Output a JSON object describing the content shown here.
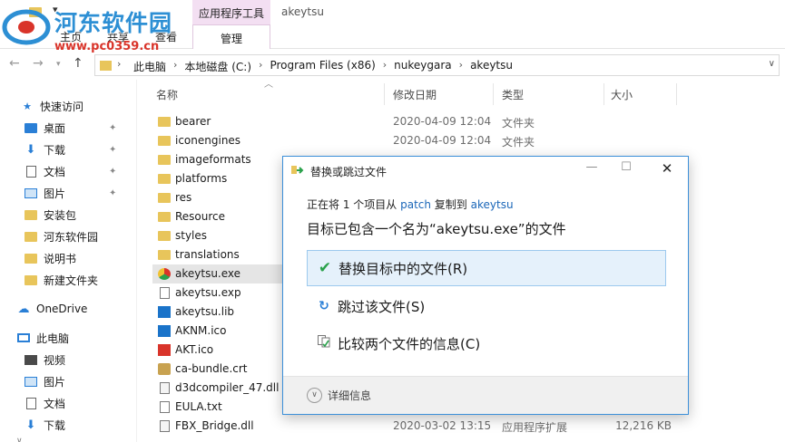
{
  "window": {
    "title": "akeytsu"
  },
  "ribbon": {
    "tabs": [
      "主页",
      "共享",
      "查看"
    ],
    "context_group": "应用程序工具",
    "context_tab": "管理"
  },
  "watermark": {
    "title": "河东软件园",
    "url": "www.pc0359.cn"
  },
  "address": {
    "crumbs": [
      "此电脑",
      "本地磁盘 (C:)",
      "Program Files (x86)",
      "nukeygara",
      "akeytsu"
    ]
  },
  "sidebar": {
    "quick_access": "快速访问",
    "items": [
      {
        "label": "桌面",
        "icon": "desktop-icon",
        "pinned": true
      },
      {
        "label": "下载",
        "icon": "download-icon",
        "pinned": true
      },
      {
        "label": "文档",
        "icon": "documents-icon",
        "pinned": true
      },
      {
        "label": "图片",
        "icon": "pictures-icon",
        "pinned": true
      },
      {
        "label": "安装包",
        "icon": "folder-icon",
        "pinned": false
      },
      {
        "label": "河东软件园",
        "icon": "folder-icon",
        "pinned": false
      },
      {
        "label": "说明书",
        "icon": "folder-icon",
        "pinned": false
      },
      {
        "label": "新建文件夹",
        "icon": "folder-icon",
        "pinned": false
      }
    ],
    "onedrive": "OneDrive",
    "this_pc": "此电脑",
    "pc_items": [
      {
        "label": "视频",
        "icon": "video-icon"
      },
      {
        "label": "图片",
        "icon": "pictures-icon"
      },
      {
        "label": "文档",
        "icon": "documents-icon"
      },
      {
        "label": "下载",
        "icon": "download-icon"
      }
    ]
  },
  "filelist": {
    "columns": {
      "name": "名称",
      "modified": "修改日期",
      "type": "类型",
      "size": "大小"
    },
    "rows": [
      {
        "name": "bearer",
        "date": "2020-04-09 12:04",
        "type": "文件夹",
        "size": "",
        "icon": "folder"
      },
      {
        "name": "iconengines",
        "date": "2020-04-09 12:04",
        "type": "文件夹",
        "size": "",
        "icon": "folder"
      },
      {
        "name": "imageformats",
        "date": "",
        "type": "",
        "size": "",
        "icon": "folder"
      },
      {
        "name": "platforms",
        "date": "",
        "type": "",
        "size": "",
        "icon": "folder"
      },
      {
        "name": "res",
        "date": "",
        "type": "",
        "size": "",
        "icon": "folder"
      },
      {
        "name": "Resource",
        "date": "",
        "type": "",
        "size": "",
        "icon": "folder"
      },
      {
        "name": "styles",
        "date": "",
        "type": "",
        "size": "",
        "icon": "folder"
      },
      {
        "name": "translations",
        "date": "",
        "type": "",
        "size": "",
        "icon": "folder"
      },
      {
        "name": "akeytsu.exe",
        "date": "",
        "type": "",
        "size": "",
        "icon": "exe"
      },
      {
        "name": "akeytsu.exp",
        "date": "",
        "type": "",
        "size": "",
        "icon": "doc"
      },
      {
        "name": "akeytsu.lib",
        "date": "",
        "type": "",
        "size": "",
        "icon": "lib"
      },
      {
        "name": "AKNM.ico",
        "date": "",
        "type": "",
        "size": "",
        "icon": "ico-blue"
      },
      {
        "name": "AKT.ico",
        "date": "",
        "type": "",
        "size": "",
        "icon": "ico-red"
      },
      {
        "name": "ca-bundle.crt",
        "date": "",
        "type": "",
        "size": "",
        "icon": "cert"
      },
      {
        "name": "d3dcompiler_47.dll",
        "date": "",
        "type": "",
        "size": "",
        "icon": "dll"
      },
      {
        "name": "EULA.txt",
        "date": "",
        "type": "",
        "size": "",
        "icon": "doc"
      },
      {
        "name": "FBX_Bridge.dll",
        "date": "2020-03-02 13:15",
        "type": "应用程序扩展",
        "size": "12,216 KB",
        "icon": "dll"
      }
    ]
  },
  "dialog": {
    "title": "替换或跳过文件",
    "line1_prefix": "正在将 1 个项目从 ",
    "line1_source": "patch",
    "line1_mid": " 复制到 ",
    "line1_dest": "akeytsu",
    "heading": "目标已包含一个名为“akeytsu.exe”的文件",
    "options": [
      {
        "label": "替换目标中的文件(R)",
        "icon": "checkmark-icon"
      },
      {
        "label": "跳过该文件(S)",
        "icon": "skip-icon"
      },
      {
        "label": "比较两个文件的信息(C)",
        "icon": "compare-icon"
      }
    ],
    "more_details": "详细信息"
  },
  "colors": {
    "accent": "#3b8fd9",
    "selection": "#e5e5e5",
    "folder": "#e8c55b",
    "context_tab": "#f3dff2"
  }
}
